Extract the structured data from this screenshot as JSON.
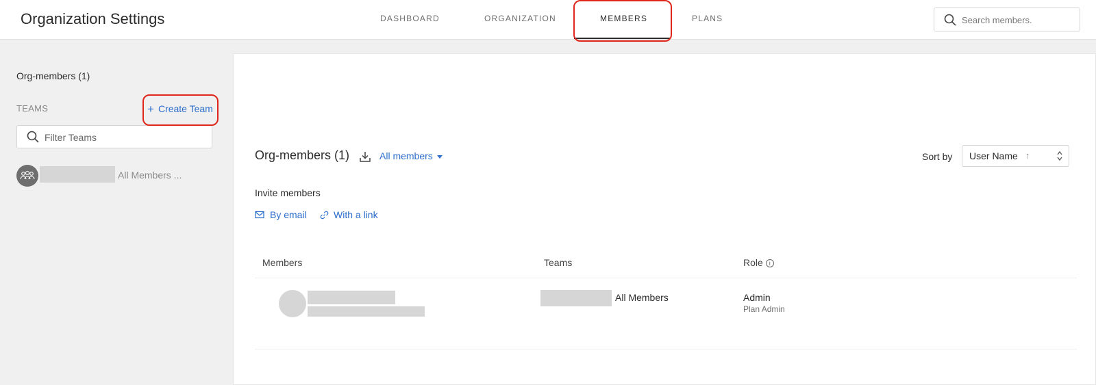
{
  "header": {
    "title": "Organization Settings",
    "tabs": [
      {
        "label": "DASHBOARD"
      },
      {
        "label": "ORGANIZATION"
      },
      {
        "label": "MEMBERS",
        "active": true
      },
      {
        "label": "PLANS"
      }
    ],
    "search_placeholder": "Search members."
  },
  "sidebar": {
    "org_members_label": "Org-members (1)",
    "teams_heading": "TEAMS",
    "create_team_label": "Create Team",
    "filter_placeholder": "Filter Teams",
    "team": {
      "name_suffix": "All Members ..."
    }
  },
  "main": {
    "title": "Org-members (1)",
    "filter_label": "All members",
    "sort_label": "Sort by",
    "sort_value": "User Name",
    "sort_direction_icon": "↑",
    "invite_label": "Invite members",
    "invite_email_label": "By email",
    "invite_link_label": "With a link",
    "columns": {
      "members": "Members",
      "teams": "Teams",
      "role": "Role"
    },
    "rows": [
      {
        "team": "All Members",
        "role": "Admin",
        "role_detail": "Plan Admin"
      }
    ]
  },
  "colors": {
    "accent": "#2c6ecb",
    "highlight": "#e0261a"
  }
}
